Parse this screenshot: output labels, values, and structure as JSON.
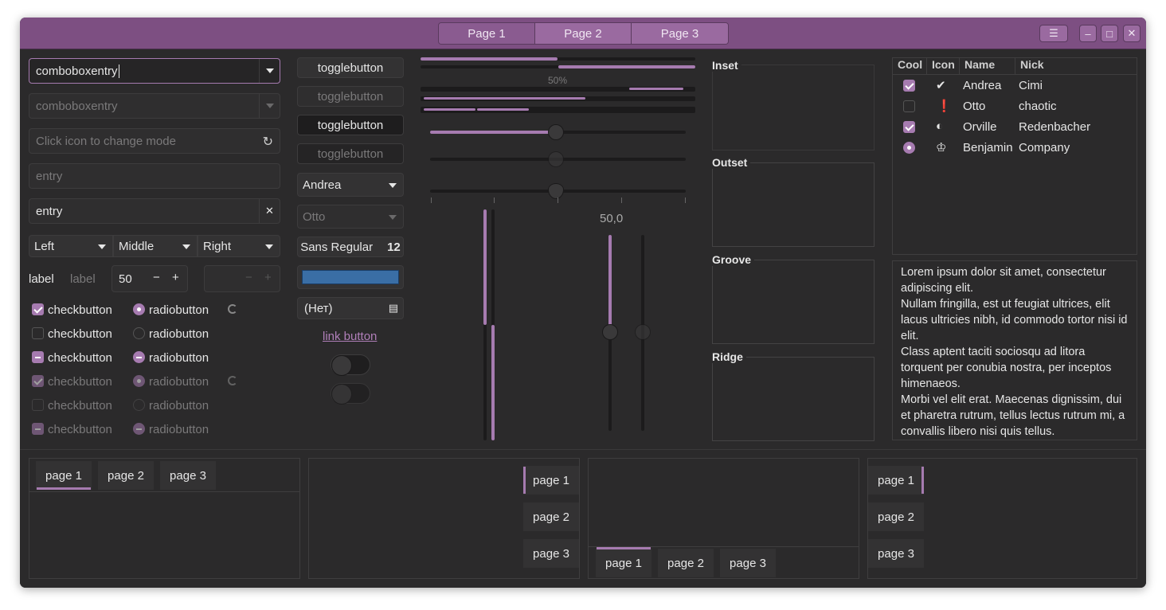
{
  "titlebar": {
    "stack": [
      "Page 1",
      "Page 2",
      "Page 3"
    ],
    "menu_icon": "hamburger-icon",
    "minimize_icon": "minimize-icon",
    "maximize_icon": "maximize-icon",
    "close_icon": "close-icon"
  },
  "entries": {
    "combo1": "comboboxentry",
    "combo2_placeholder": "comboboxentry",
    "mode_placeholder": "Click icon to change mode",
    "entry_placeholder": "entry",
    "entry_value": "entry"
  },
  "combos": {
    "left": "Left",
    "middle": "Middle",
    "right": "Right"
  },
  "labels": {
    "label1": "label",
    "label2": "label"
  },
  "spin": {
    "value": "50"
  },
  "checks": [
    "checkbutton",
    "checkbutton",
    "checkbutton",
    "checkbutton",
    "checkbutton",
    "checkbutton"
  ],
  "radios": [
    "radiobutton",
    "radiobutton",
    "radiobutton",
    "radiobutton",
    "radiobutton",
    "radiobutton"
  ],
  "toggles": [
    "togglebutton",
    "togglebutton",
    "togglebutton",
    "togglebutton"
  ],
  "combo_names": {
    "andrea": "Andrea",
    "otto": "Otto"
  },
  "font": {
    "name": "Sans Regular",
    "size": "12"
  },
  "color_button": "#3a6ea5",
  "file_button": "(Нет)",
  "link_button": "link button",
  "progress_label": "50%",
  "scale_value": "50,0",
  "frames": [
    "Inset",
    "Outset",
    "Groove",
    "Ridge"
  ],
  "tree": {
    "headers": [
      "Cool",
      "Icon",
      "Name",
      "Nick"
    ],
    "rows": [
      {
        "name": "Andrea",
        "nick": "Cimi"
      },
      {
        "name": "Otto",
        "nick": "chaotic"
      },
      {
        "name": "Orville",
        "nick": "Redenbacher"
      },
      {
        "name": "Benjamin",
        "nick": "Company"
      }
    ]
  },
  "text": [
    "Lorem ipsum dolor sit amet, consectetur adipiscing elit.",
    "Nullam fringilla, est ut feugiat ultrices, elit lacus ultricies nibh, id commodo tortor nisi id elit.",
    "Class aptent taciti sociosqu ad litora torquent per conubia nostra, per inceptos himenaeos.",
    "Morbi vel elit erat. Maecenas dignissim, dui et pharetra rutrum, tellus lectus rutrum mi, a convallis libero nisi quis tellus."
  ],
  "notebook_tabs": [
    "page 1",
    "page 2",
    "page 3"
  ],
  "colors": {
    "accent": "#a67bb0",
    "titlebar": "#7d4f82",
    "background": "#2b2a2b"
  }
}
